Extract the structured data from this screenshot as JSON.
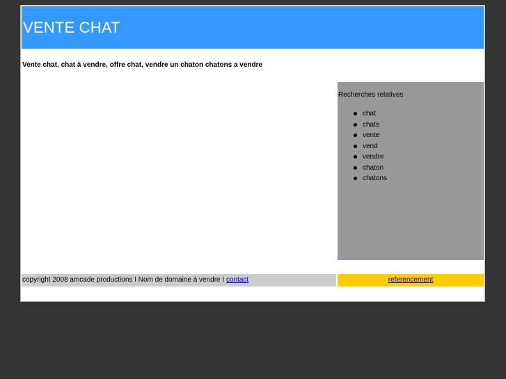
{
  "header": {
    "title": "VENTE CHAT"
  },
  "main": {
    "keywords": "Vente chat, chat à vendre, offre chat, vendre un chaton chatons a vendre"
  },
  "related": {
    "title": "Recherches relatives",
    "items": [
      "chat",
      "chats",
      "vente",
      "vend",
      "vendre",
      "chaton",
      "chatons"
    ]
  },
  "footer": {
    "copyright": "copyright 2008 amcade productions I Nom de domaine à vendre I ",
    "contact_label": "contact",
    "referencement_label": "referencement"
  },
  "colors": {
    "background": "#333333",
    "header": "#3399ff",
    "sidebar": "#999999",
    "footer_left": "#cccccc",
    "footer_right": "#ffcc00",
    "link": "#0000ee"
  }
}
